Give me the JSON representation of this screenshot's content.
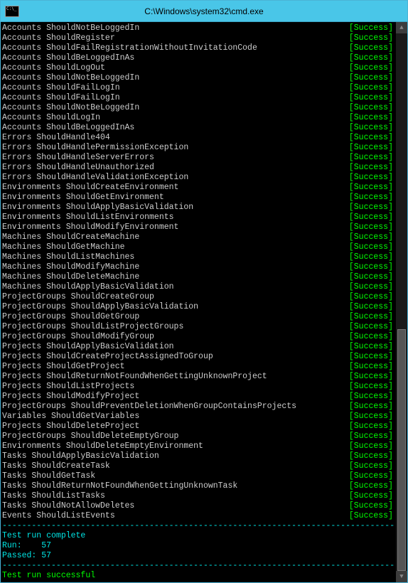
{
  "window": {
    "title": "C:\\Windows\\system32\\cmd.exe",
    "icon": "cmd-icon"
  },
  "status_label": "[Success]",
  "tests": [
    {
      "suite": "Accounts",
      "name": "ShouldNotBeLoggedIn",
      "status": "Success"
    },
    {
      "suite": "Accounts",
      "name": "ShouldRegister",
      "status": "Success"
    },
    {
      "suite": "Accounts",
      "name": "ShouldFailRegistrationWithoutInvitationCode",
      "status": "Success"
    },
    {
      "suite": "Accounts",
      "name": "ShouldBeLoggedInAs",
      "status": "Success"
    },
    {
      "suite": "Accounts",
      "name": "ShouldLogOut",
      "status": "Success"
    },
    {
      "suite": "Accounts",
      "name": "ShouldNotBeLoggedIn",
      "status": "Success"
    },
    {
      "suite": "Accounts",
      "name": "ShouldFailLogIn",
      "status": "Success"
    },
    {
      "suite": "Accounts",
      "name": "ShouldFailLogIn",
      "status": "Success"
    },
    {
      "suite": "Accounts",
      "name": "ShouldNotBeLoggedIn",
      "status": "Success"
    },
    {
      "suite": "Accounts",
      "name": "ShouldLogIn",
      "status": "Success"
    },
    {
      "suite": "Accounts",
      "name": "ShouldBeLoggedInAs",
      "status": "Success"
    },
    {
      "suite": "Errors",
      "name": "ShouldHandle404",
      "status": "Success"
    },
    {
      "suite": "Errors",
      "name": "ShouldHandlePermissionException",
      "status": "Success"
    },
    {
      "suite": "Errors",
      "name": "ShouldHandleServerErrors",
      "status": "Success"
    },
    {
      "suite": "Errors",
      "name": "ShouldHandleUnauthorized",
      "status": "Success"
    },
    {
      "suite": "Errors",
      "name": "ShouldHandleValidationException",
      "status": "Success"
    },
    {
      "suite": "Environments",
      "name": "ShouldCreateEnvironment",
      "status": "Success"
    },
    {
      "suite": "Environments",
      "name": "ShouldGetEnvironment",
      "status": "Success"
    },
    {
      "suite": "Environments",
      "name": "ShouldApplyBasicValidation",
      "status": "Success"
    },
    {
      "suite": "Environments",
      "name": "ShouldListEnvironments",
      "status": "Success"
    },
    {
      "suite": "Environments",
      "name": "ShouldModifyEnvironment",
      "status": "Success"
    },
    {
      "suite": "Machines",
      "name": "ShouldCreateMachine",
      "status": "Success"
    },
    {
      "suite": "Machines",
      "name": "ShouldGetMachine",
      "status": "Success"
    },
    {
      "suite": "Machines",
      "name": "ShouldListMachines",
      "status": "Success"
    },
    {
      "suite": "Machines",
      "name": "ShouldModifyMachine",
      "status": "Success"
    },
    {
      "suite": "Machines",
      "name": "ShouldDeleteMachine",
      "status": "Success"
    },
    {
      "suite": "Machines",
      "name": "ShouldApplyBasicValidation",
      "status": "Success"
    },
    {
      "suite": "ProjectGroups",
      "name": "ShouldCreateGroup",
      "status": "Success"
    },
    {
      "suite": "ProjectGroups",
      "name": "ShouldApplyBasicValidation",
      "status": "Success"
    },
    {
      "suite": "ProjectGroups",
      "name": "ShouldGetGroup",
      "status": "Success"
    },
    {
      "suite": "ProjectGroups",
      "name": "ShouldListProjectGroups",
      "status": "Success"
    },
    {
      "suite": "ProjectGroups",
      "name": "ShouldModifyGroup",
      "status": "Success"
    },
    {
      "suite": "Projects",
      "name": "ShouldApplyBasicValidation",
      "status": "Success"
    },
    {
      "suite": "Projects",
      "name": "ShouldCreateProjectAssignedToGroup",
      "status": "Success"
    },
    {
      "suite": "Projects",
      "name": "ShouldGetProject",
      "status": "Success"
    },
    {
      "suite": "Projects",
      "name": "ShouldReturnNotFoundWhenGettingUnknownProject",
      "status": "Success"
    },
    {
      "suite": "Projects",
      "name": "ShouldListProjects",
      "status": "Success"
    },
    {
      "suite": "Projects",
      "name": "ShouldModifyProject",
      "status": "Success"
    },
    {
      "suite": "ProjectGroups",
      "name": "ShouldPreventDeletionWhenGroupContainsProjects",
      "status": "Success"
    },
    {
      "suite": "Variables",
      "name": "ShouldGetVariables",
      "status": "Success"
    },
    {
      "suite": "Projects",
      "name": "ShouldDeleteProject",
      "status": "Success"
    },
    {
      "suite": "ProjectGroups",
      "name": "ShouldDeleteEmptyGroup",
      "status": "Success"
    },
    {
      "suite": "Environments",
      "name": "ShouldDeleteEmptyEnvironment",
      "status": "Success"
    },
    {
      "suite": "Tasks",
      "name": "ShouldApplyBasicValidation",
      "status": "Success"
    },
    {
      "suite": "Tasks",
      "name": "ShouldCreateTask",
      "status": "Success"
    },
    {
      "suite": "Tasks",
      "name": "ShouldGetTask",
      "status": "Success"
    },
    {
      "suite": "Tasks",
      "name": "ShouldReturnNotFoundWhenGettingUnknownTask",
      "status": "Success"
    },
    {
      "suite": "Tasks",
      "name": "ShouldListTasks",
      "status": "Success"
    },
    {
      "suite": "Tasks",
      "name": "ShouldNotAllowDeletes",
      "status": "Success"
    },
    {
      "suite": "Events",
      "name": "ShouldListEvents",
      "status": "Success"
    }
  ],
  "divider": "--------------------------------------------------------------------------------",
  "summary": {
    "complete_label": "Test run complete",
    "run_label": "Run:",
    "run_value": "57",
    "passed_label": "Passed:",
    "passed_value": "57",
    "success_label": "Test run successful"
  },
  "scrollbar": {
    "thumb_top_pct": 55,
    "thumb_height_pct": 45
  }
}
